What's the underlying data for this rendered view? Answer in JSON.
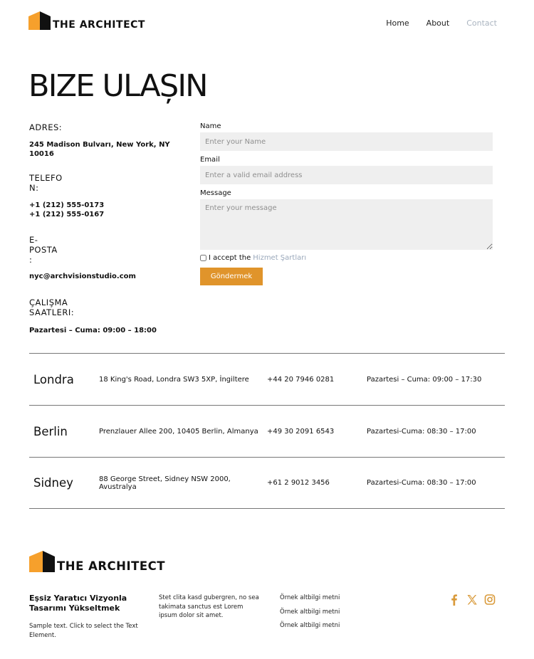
{
  "brand": {
    "name": "THE ARCHITECT",
    "color_orange": "#f6a02c",
    "color_dark": "#111111"
  },
  "nav": [
    {
      "label": "Home",
      "active": false
    },
    {
      "label": "About",
      "active": false
    },
    {
      "label": "Contact",
      "active": true
    }
  ],
  "page_title": "BIZE ULAȘIN",
  "info": {
    "address_label": "ADRES:",
    "address_value": "245 Madison Bulvarı, New York, NY 10016",
    "phone_label_1": "TELEFO",
    "phone_label_2": "N:",
    "phone_1": "+1 (212) 555-0173",
    "phone_2": "+1 (212) 555-0167",
    "email_label_1": "E-",
    "email_label_2": "POSTA",
    "email_label_3": ":",
    "email_value": "nyc@archvisionstudio.com",
    "hours_label_1": "ÇALIŞMA",
    "hours_label_2": "SAATLERI:",
    "hours_value": "Pazartesi – Cuma: 09:00 – 18:00"
  },
  "form": {
    "name_label": "Name",
    "name_placeholder": "Enter your Name",
    "email_label": "Email",
    "email_placeholder": "Enter a valid email address",
    "message_label": "Message",
    "message_placeholder": "Enter your message",
    "terms_prefix": "I accept the",
    "terms_link": "Hizmet Şartları",
    "submit": "Göndermek",
    "accent_color": "#e0942b"
  },
  "offices": [
    {
      "city": "Londra",
      "address": "18 King's Road, Londra SW3 5XP, İngiltere",
      "phone": "+44 20 7946 0281",
      "hours": "Pazartesi – Cuma: 09:00 – 17:30"
    },
    {
      "city": "Berlin",
      "address": "Prenzlauer Allee 200, 10405 Berlin, Almanya",
      "phone": "+49 30 2091 6543",
      "hours": "Pazartesi-Cuma: 08:30 – 17:00"
    },
    {
      "city": "Sidney",
      "address": "88 George Street, Sidney NSW 2000, Avustralya",
      "phone": "+61 2 9012 3456",
      "hours": "Pazartesi-Cuma: 08:30 – 17:00"
    }
  ],
  "footer": {
    "heading": "Eşsiz Yaratıcı Vizyonla Tasarımı Yükseltmek",
    "sample_text": "Sample text. Click to select the Text Element.",
    "lorem": "Stet clita kasd gubergren, no sea takimata sanctus est Lorem ipsum dolor sit amet.",
    "links": [
      "Örnek altbilgi metni",
      "Örnek altbilgi metni",
      "Örnek altbilgi metni"
    ],
    "social_icons": [
      "facebook-icon",
      "x-twitter-icon",
      "instagram-icon"
    ],
    "social_color": "#d99a3a"
  }
}
